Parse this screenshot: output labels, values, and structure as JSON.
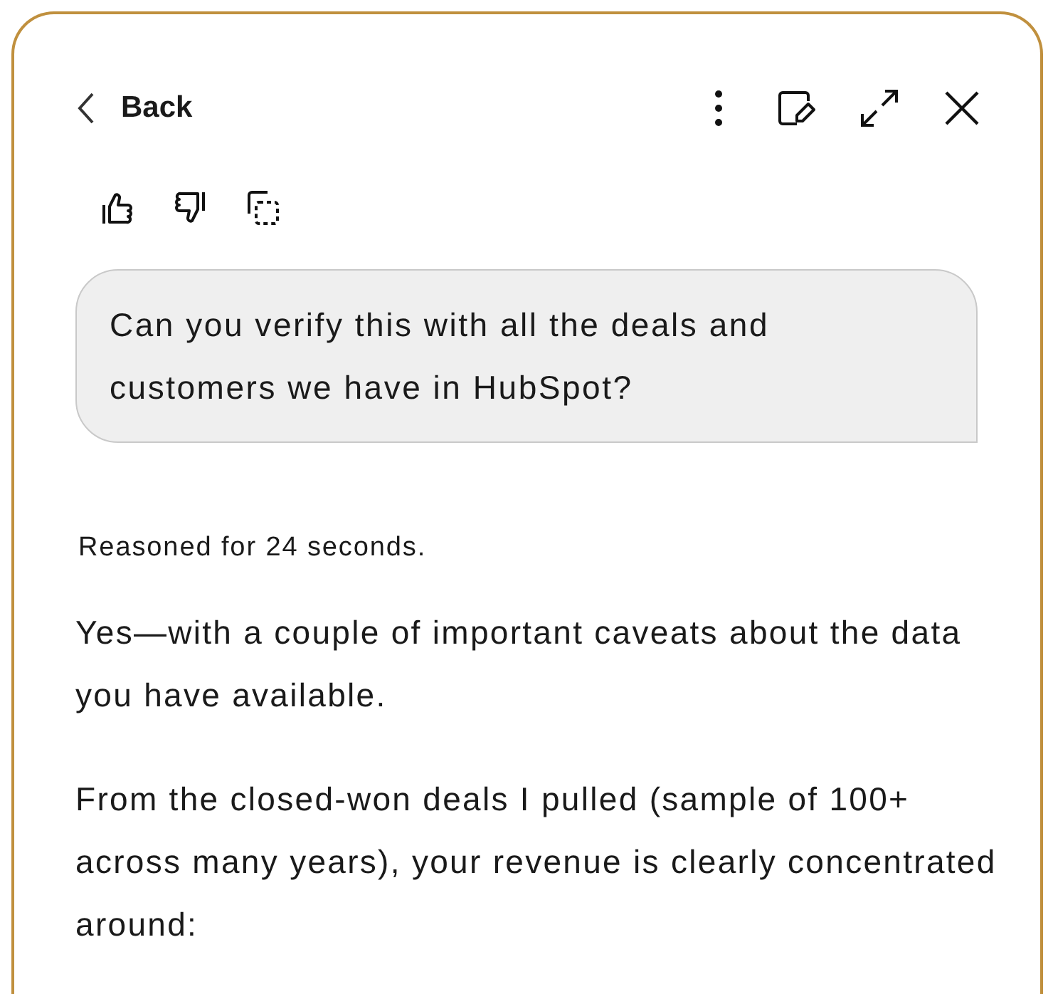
{
  "header": {
    "back_label": "Back"
  },
  "message_actions": [
    {
      "kind": "like"
    },
    {
      "kind": "dislike"
    },
    {
      "kind": "copy"
    }
  ],
  "user_message": "Can you verify this with all the deals and customers we have in HubSpot?",
  "reasoning_note": "Reasoned for 24 seconds.",
  "response_paragraphs": [
    "Yes—with a couple of important caveats about the data you have available.",
    "From the closed-won deals I pulled (sample of 100+ across many years), your revenue is clearly concentrated around:"
  ]
}
